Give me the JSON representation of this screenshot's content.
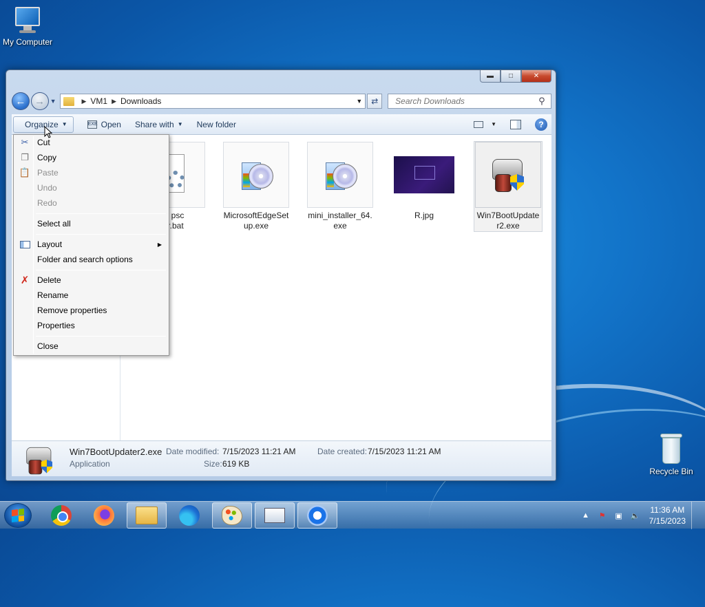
{
  "desktop": {
    "icons": [
      {
        "label": "My Computer",
        "icon": "computer-icon"
      },
      {
        "label": "Recycle Bin",
        "icon": "recycle-bin-icon"
      }
    ]
  },
  "window": {
    "caption_buttons": {
      "minimize": "minimize",
      "maximize": "maximize",
      "close": "close"
    },
    "address": {
      "crumbs": [
        "VM1",
        "Downloads"
      ]
    },
    "search": {
      "placeholder": "Search Downloads"
    },
    "toolbar": {
      "organize": "Organize",
      "open": "Open",
      "share_with": "Share with",
      "new_folder": "New folder"
    },
    "files": [
      {
        "name": "...ux psc\n...tor.bat",
        "line1": "ux psc",
        "line2": "tor.bat",
        "icon": "batch-file-icon"
      },
      {
        "name": "MicrosoftEdgeSetup.exe",
        "line1": "MicrosoftEdgeSet",
        "line2": "up.exe",
        "icon": "installer-cd-icon"
      },
      {
        "name": "mini_installer_64.exe",
        "line1": "mini_installer_64.",
        "line2": "exe",
        "icon": "installer-cd-icon"
      },
      {
        "name": "R.jpg",
        "line1": "R.jpg",
        "line2": "",
        "icon": "image-thumbnail"
      },
      {
        "name": "Win7BootUpdater2.exe",
        "line1": "Win7BootUpdate",
        "line2": "r2.exe",
        "icon": "boot-updater-icon"
      }
    ],
    "details": {
      "name": "Win7BootUpdater2.exe",
      "type": "Application",
      "modified_label": "Date modified:",
      "modified_value": "7/15/2023 11:21 AM",
      "created_label": "Date created:",
      "created_value": "7/15/2023 11:21 AM",
      "size_label": "Size:",
      "size_value": "619 KB"
    }
  },
  "organize_menu": {
    "items": [
      {
        "label": "Cut",
        "enabled": true,
        "icon": "scissors-icon"
      },
      {
        "label": "Copy",
        "enabled": true,
        "icon": "copy-icon"
      },
      {
        "label": "Paste",
        "enabled": false,
        "icon": "paste-icon"
      },
      {
        "label": "Undo",
        "enabled": false
      },
      {
        "label": "Redo",
        "enabled": false
      },
      {
        "label": "Select all",
        "enabled": true
      },
      {
        "label": "Layout",
        "enabled": true,
        "icon": "layout-icon",
        "submenu": true
      },
      {
        "label": "Folder and search options",
        "enabled": true
      },
      {
        "label": "Delete",
        "enabled": true,
        "icon": "delete-x-icon"
      },
      {
        "label": "Rename",
        "enabled": true
      },
      {
        "label": "Remove properties",
        "enabled": true
      },
      {
        "label": "Properties",
        "enabled": true
      },
      {
        "label": "Close",
        "enabled": true
      }
    ]
  },
  "taskbar": {
    "apps": [
      "Google Chrome",
      "Firefox",
      "Windows Explorer",
      "Microsoft Edge",
      "Paint",
      "On-Screen Keyboard",
      "Chromium"
    ],
    "clock": {
      "time": "11:36 AM",
      "date": "7/15/2023"
    }
  }
}
